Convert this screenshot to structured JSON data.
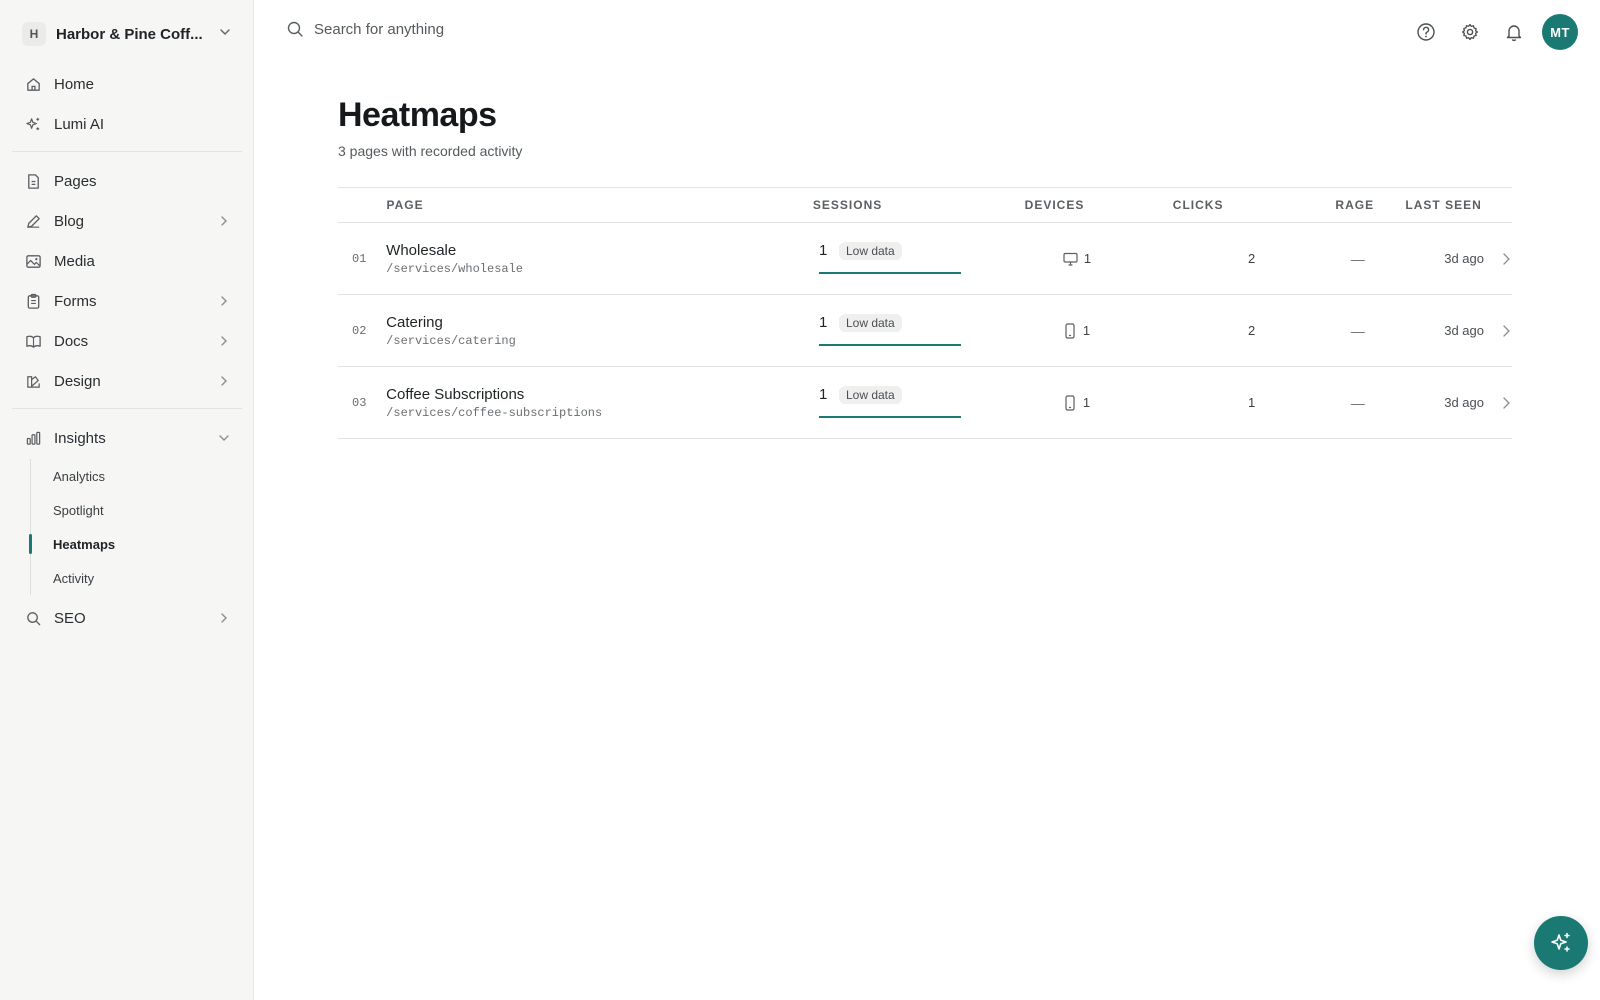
{
  "workspace": {
    "badge": "H",
    "name": "Harbor & Pine Coff..."
  },
  "sidebar": {
    "group1": [
      {
        "label": "Home",
        "icon": "home-icon"
      },
      {
        "label": "Lumi AI",
        "icon": "sparkles-icon"
      }
    ],
    "group2": [
      {
        "label": "Pages",
        "icon": "file-icon"
      },
      {
        "label": "Blog",
        "icon": "pencil-icon",
        "expandable": true
      },
      {
        "label": "Media",
        "icon": "image-icon"
      },
      {
        "label": "Forms",
        "icon": "clipboard-icon",
        "expandable": true
      },
      {
        "label": "Docs",
        "icon": "book-icon",
        "expandable": true
      },
      {
        "label": "Design",
        "icon": "palette-icon",
        "expandable": true
      }
    ],
    "insights": {
      "label": "Insights",
      "icon": "bar-chart-icon",
      "expanded": true,
      "children": [
        {
          "label": "Analytics",
          "active": false
        },
        {
          "label": "Spotlight",
          "active": false
        },
        {
          "label": "Heatmaps",
          "active": true
        },
        {
          "label": "Activity",
          "active": false
        }
      ]
    },
    "seo": {
      "label": "SEO",
      "icon": "search-icon",
      "expandable": true
    }
  },
  "topbar": {
    "search_placeholder": "Search for anything",
    "avatar_initials": "MT"
  },
  "page": {
    "title": "Heatmaps",
    "subtitle": "3 pages with recorded activity"
  },
  "table": {
    "headers": {
      "page": "PAGE",
      "sessions": "SESSIONS",
      "devices": "DEVICES",
      "clicks": "CLICKS",
      "rage": "RAGE",
      "last_seen": "LAST SEEN"
    },
    "rows": [
      {
        "num": "01",
        "name": "Wholesale",
        "path": "/services/wholesale",
        "sessions": "1",
        "badge": "Low data",
        "sessions_fill": 1.0,
        "device_icon": "monitor-icon",
        "devices": "1",
        "clicks": "2",
        "rage": "—",
        "last_seen": "3d ago"
      },
      {
        "num": "02",
        "name": "Catering",
        "path": "/services/catering",
        "sessions": "1",
        "badge": "Low data",
        "sessions_fill": 1.0,
        "device_icon": "phone-icon",
        "devices": "1",
        "clicks": "2",
        "rage": "—",
        "last_seen": "3d ago"
      },
      {
        "num": "03",
        "name": "Coffee Subscriptions",
        "path": "/services/coffee-subscriptions",
        "sessions": "1",
        "badge": "Low data",
        "sessions_fill": 1.0,
        "device_icon": "phone-icon",
        "devices": "1",
        "clicks": "1",
        "rage": "—",
        "last_seen": "3d ago"
      }
    ]
  },
  "colors": {
    "accent": "#1a7a73"
  }
}
